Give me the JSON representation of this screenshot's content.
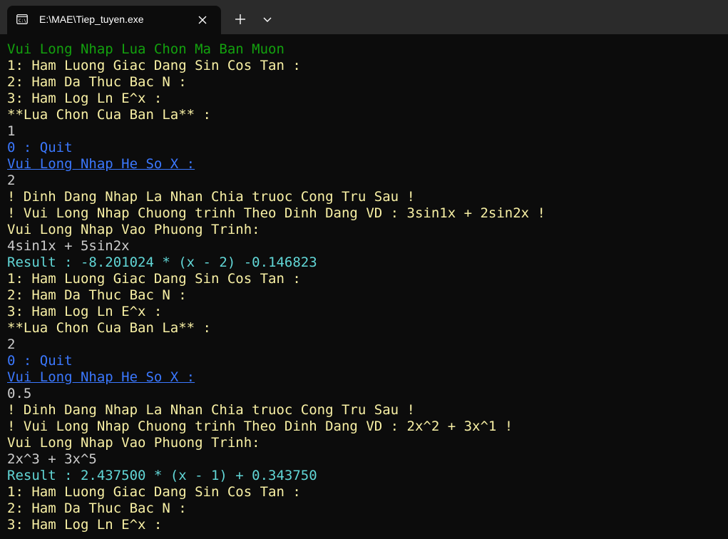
{
  "window": {
    "tab_title": "E:\\MAE\\Tiep_tuyen.exe"
  },
  "icons": {
    "tab_icon": "terminal-icon",
    "close": "close-icon",
    "new_tab": "plus-icon",
    "dropdown": "chevron-down-icon"
  },
  "colors": {
    "background": "#0c0c0c",
    "titlebar": "#2b2b2b",
    "green": "#13a10e",
    "yellow": "#f9f1a5",
    "white": "#cccccc",
    "blue": "#3b78ff",
    "cyan": "#61d6d6"
  },
  "console": {
    "lines": [
      {
        "text": "Vui Long Nhap Lua Chon Ma Ban Muon",
        "color": "green"
      },
      {
        "text": "1: Ham Luong Giac Dang Sin Cos Tan :",
        "color": "yellow"
      },
      {
        "text": "2: Ham Da Thuc Bac N :",
        "color": "yellow"
      },
      {
        "text": "3: Ham Log Ln E^x :",
        "color": "yellow"
      },
      {
        "text": "**Lua Chon Cua Ban La** :",
        "color": "yellow"
      },
      {
        "text": "1",
        "color": "white"
      },
      {
        "text": "0 : Quit",
        "color": "blue"
      },
      {
        "text": "Vui Long Nhap He So X :",
        "color": "bluelink"
      },
      {
        "text": "2",
        "color": "white"
      },
      {
        "text": "! Dinh Dang Nhap La Nhan Chia truoc Cong Tru Sau !",
        "color": "yellow"
      },
      {
        "text": "! Vui Long Nhap Chuong trinh Theo Dinh Dang VD : 3sin1x + 2sin2x !",
        "color": "yellow"
      },
      {
        "text": "Vui Long Nhap Vao Phuong Trinh:",
        "color": "yellow"
      },
      {
        "text": "4sin1x + 5sin2x",
        "color": "white"
      },
      {
        "text": "Result : -8.201024 * (x - 2) -0.146823",
        "color": "cyan"
      },
      {
        "text": "1: Ham Luong Giac Dang Sin Cos Tan :",
        "color": "yellow"
      },
      {
        "text": "2: Ham Da Thuc Bac N :",
        "color": "yellow"
      },
      {
        "text": "3: Ham Log Ln E^x :",
        "color": "yellow"
      },
      {
        "text": "**Lua Chon Cua Ban La** :",
        "color": "yellow"
      },
      {
        "text": "2",
        "color": "white"
      },
      {
        "text": "0 : Quit",
        "color": "blue"
      },
      {
        "text": "Vui Long Nhap He So X :",
        "color": "bluelink"
      },
      {
        "text": "0.5",
        "color": "white"
      },
      {
        "text": "! Dinh Dang Nhap La Nhan Chia truoc Cong Tru Sau !",
        "color": "yellow"
      },
      {
        "text": "! Vui Long Nhap Chuong trinh Theo Dinh Dang VD : 2x^2 + 3x^1 !",
        "color": "yellow"
      },
      {
        "text": "Vui Long Nhap Vao Phuong Trinh:",
        "color": "yellow"
      },
      {
        "text": "2x^3 + 3x^5",
        "color": "white"
      },
      {
        "text": "Result : 2.437500 * (x - 1) + 0.343750",
        "color": "cyan"
      },
      {
        "text": "1: Ham Luong Giac Dang Sin Cos Tan :",
        "color": "yellow"
      },
      {
        "text": "2: Ham Da Thuc Bac N :",
        "color": "yellow"
      },
      {
        "text": "3: Ham Log Ln E^x :",
        "color": "yellow"
      }
    ]
  }
}
